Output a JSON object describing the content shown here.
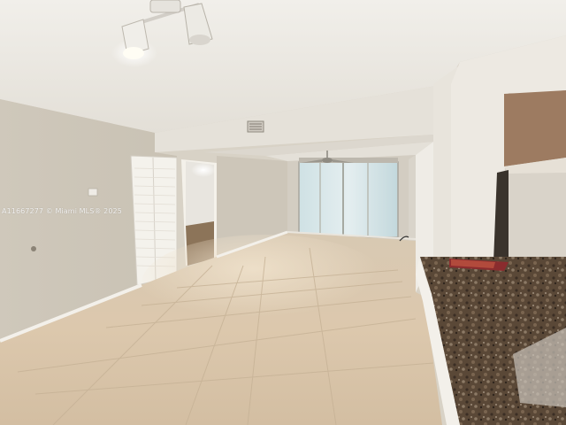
{
  "photo": {
    "watermark": "A11667277 © Miami MLS® 2025"
  },
  "colors": {
    "wall_left": "#ccc5b8",
    "wall_back": "#d4cfc4",
    "ceiling": "#ece9e2",
    "floor": "#d9c7ae",
    "baseboard": "#f2efe8",
    "counter": "#5b4a3a",
    "window": "#c9dce0",
    "cabinet": "#9c7a60"
  }
}
